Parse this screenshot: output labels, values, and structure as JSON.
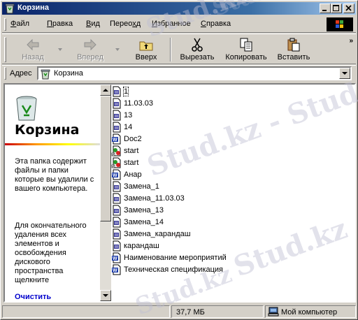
{
  "window": {
    "title": "Корзина"
  },
  "menu": [
    {
      "label": "Файл",
      "u": "Ф",
      "rest": "айл"
    },
    {
      "label": "Правка",
      "u": "П",
      "rest": "равка"
    },
    {
      "label": "Вид",
      "u": "В",
      "rest": "ид"
    },
    {
      "label": "Переход",
      "u": "х",
      "pre": "Перео",
      "rest": "д"
    },
    {
      "label": "Избранное",
      "u": "И",
      "rest": "збранное"
    },
    {
      "label": "Справка",
      "u": "С",
      "rest": "правка"
    }
  ],
  "toolbar": {
    "back": "Назад",
    "forward": "Вперед",
    "up": "Вверх",
    "cut": "Вырезать",
    "copy": "Копировать",
    "paste": "Вставить",
    "more": "»"
  },
  "address": {
    "label": "Адрес",
    "value": "Корзина"
  },
  "panel": {
    "title": "Корзина",
    "description": "Эта папка содержит файлы и папки которые вы удалили с вашего компьютера.",
    "instructions": "Для окончательного удаления всех элементов и освобождения дискового пространства щелкните",
    "link": "Очистить"
  },
  "files": [
    {
      "name": "1",
      "icon": "text-file-icon"
    },
    {
      "name": "11.03.03",
      "icon": "text-file-icon"
    },
    {
      "name": "13",
      "icon": "text-file-icon"
    },
    {
      "name": "14",
      "icon": "text-file-icon"
    },
    {
      "name": "Doc2",
      "icon": "word-doc-icon"
    },
    {
      "name": "start",
      "icon": "shortcut-icon"
    },
    {
      "name": "start",
      "icon": "shortcut-icon"
    },
    {
      "name": "Анар",
      "icon": "word-doc-icon"
    },
    {
      "name": "Замена_1",
      "icon": "text-file-icon"
    },
    {
      "name": "Замена_11.03.03",
      "icon": "text-file-icon"
    },
    {
      "name": "Замена_13",
      "icon": "text-file-icon"
    },
    {
      "name": "Замена_14",
      "icon": "text-file-icon"
    },
    {
      "name": "Замена_карандаш",
      "icon": "text-file-icon"
    },
    {
      "name": "карандаш",
      "icon": "text-file-icon"
    },
    {
      "name": "Наименование мероприятий",
      "icon": "word-doc-icon"
    },
    {
      "name": "Техническая спецификация",
      "icon": "word-doc-icon"
    }
  ],
  "status": {
    "size": "37,7 МБ",
    "location": "Мой компьютер"
  },
  "watermarks": [
    "Stud.kz",
    "Stud.kz - Stud.kz",
    "Stud.kz",
    "Stud.kz",
    "Stud.kz"
  ]
}
